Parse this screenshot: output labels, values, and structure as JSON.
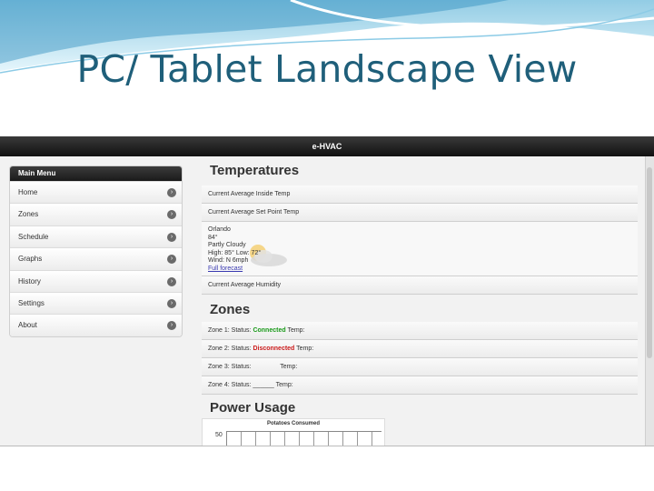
{
  "slide_title": "PC/ Tablet Landscape View",
  "app": {
    "header_title": "e-HVAC",
    "menu": {
      "title": "Main Menu",
      "items": [
        {
          "label": "Home"
        },
        {
          "label": "Zones"
        },
        {
          "label": "Schedule"
        },
        {
          "label": "Graphs"
        },
        {
          "label": "History"
        },
        {
          "label": "Settings"
        },
        {
          "label": "About"
        }
      ]
    },
    "temperatures": {
      "heading": "Temperatures",
      "inside_temp": "Current Average Inside Temp",
      "set_point": "Current Average Set Point Temp",
      "weather": {
        "city": "Orlando",
        "temp": "84°",
        "condition": "Partly Cloudy",
        "hilo": "High: 85° Low: 72°",
        "wind": "Wind: N 6mph",
        "forecast_link": "Full forecast"
      },
      "humidity": "Current Average Humidity"
    },
    "zones": {
      "heading": "Zones",
      "rows": [
        {
          "prefix": "Zone 1: Status:",
          "status": "Connected",
          "suffix": "Temp:"
        },
        {
          "prefix": "Zone 2: Status:",
          "status": "Disconnected",
          "suffix": "Temp:"
        },
        {
          "prefix": "Zone 3: Status:",
          "status": "",
          "suffix": "Temp:"
        },
        {
          "prefix": "Zone 4: Status: ______",
          "status": "",
          "suffix": "Temp:"
        }
      ]
    },
    "power": {
      "heading": "Power Usage",
      "chart_title": "Potatoes Consumed",
      "y_tick": "50"
    }
  },
  "colors": {
    "title": "#1f5f7a",
    "connected": "#1a9a1a",
    "disconnected": "#cc1c1c",
    "accent": "#4a9fd0"
  }
}
